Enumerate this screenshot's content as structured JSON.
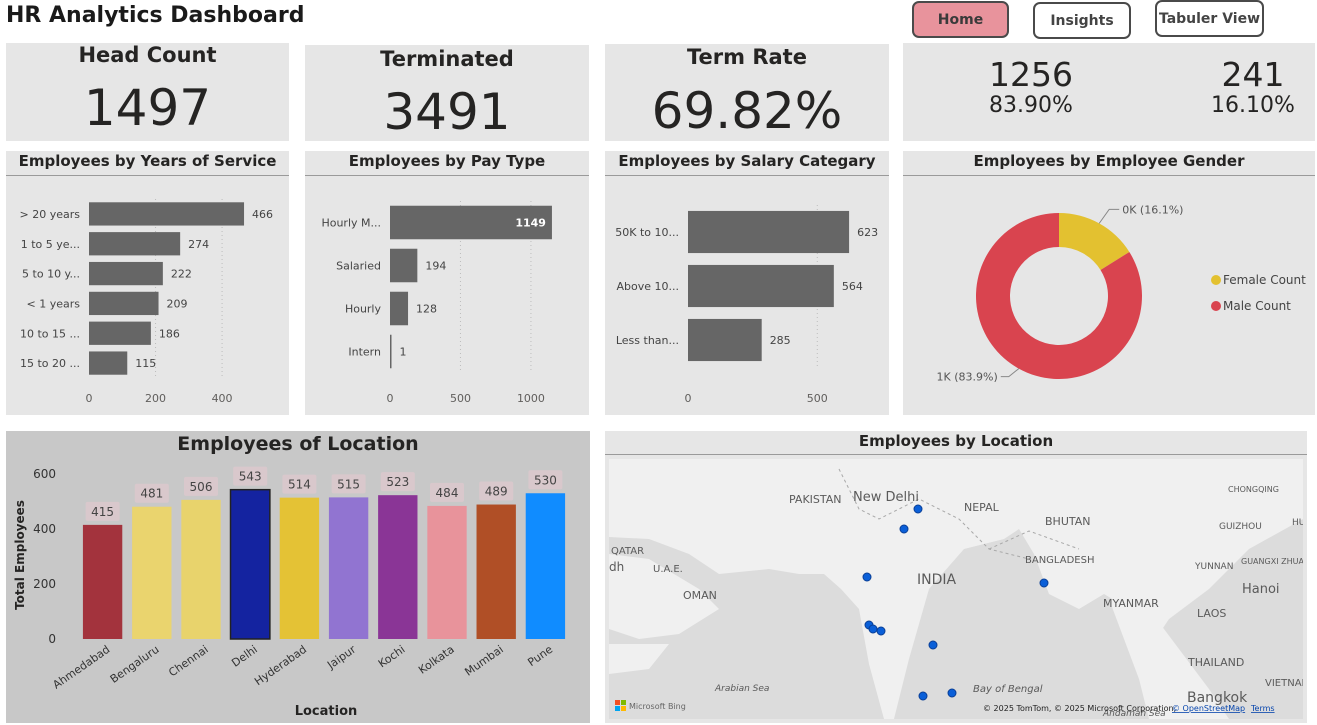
{
  "header": {
    "title": "HR Analytics Dashboard",
    "nav": [
      "Home",
      "Insights",
      "Tabuler View"
    ]
  },
  "kpis": [
    {
      "label": "Head Count",
      "value": "1497"
    },
    {
      "label": "Terminated",
      "value": "3491"
    },
    {
      "label": "Term Rate",
      "value": "69.82%"
    }
  ],
  "split": {
    "left_count": "1256",
    "left_pct": "83.90%",
    "right_count": "241",
    "right_pct": "16.10%"
  },
  "panels": {
    "service_title": "Employees by Years of Service",
    "paytype_title": "Employees by Pay Type",
    "salary_title": "Employees by Salary Categary",
    "gender_title": "Employees by Employee Gender",
    "location_title": "Employees of Location",
    "map_title": "Employees by Location"
  },
  "map": {
    "labels": [
      "PAKISTAN",
      "New Delhi",
      "NEPAL",
      "BHUTAN",
      "BANGLADESH",
      "INDIA",
      "OMAN",
      "QATAR",
      "U.A.E.",
      "dh",
      "MYANMAR",
      "LAOS",
      "Hanoi",
      "YUNNAN",
      "GUIZHOU",
      "GUANGXI ZHUANG",
      "CHONGQING",
      "HU",
      "VIETNAM",
      "THAILAND",
      "Bangkok",
      "Arabian Sea",
      "Bay of Bengal",
      "Andaman Sea"
    ],
    "attribution": "© 2025 TomTom, © 2025 Microsoft Corporation,",
    "osm_link": "© OpenStreetMap",
    "terms_link": "Terms",
    "bing_label": "Microsoft Bing"
  },
  "colors": {
    "bar_gray": "#666666",
    "female": "#e3c130",
    "male": "#d9444f",
    "home_active": "#e8939c",
    "map_dot": "#0a5fd8"
  },
  "chart_data": [
    {
      "id": "service",
      "type": "bar",
      "orientation": "horizontal",
      "title": "Employees by Years of Service",
      "categories": [
        "> 20 years",
        "1 to 5 ye...",
        "5 to 10 y...",
        "< 1 years",
        "10 to 15 ...",
        "15 to 20 ..."
      ],
      "values": [
        466,
        274,
        222,
        209,
        186,
        115
      ],
      "xlim": [
        0,
        520
      ],
      "ticks": [
        0,
        200,
        400
      ]
    },
    {
      "id": "paytype",
      "type": "bar",
      "orientation": "horizontal",
      "title": "Employees by Pay Type",
      "categories": [
        "Hourly M...",
        "Salaried",
        "Hourly",
        "Intern"
      ],
      "values": [
        1149,
        194,
        128,
        1
      ],
      "xlim": [
        0,
        1270
      ],
      "ticks": [
        0,
        500,
        1000
      ]
    },
    {
      "id": "salary",
      "type": "bar",
      "orientation": "horizontal",
      "title": "Employees by Salary Categary",
      "categories": [
        "50K to 10...",
        "Above 10...",
        "Less than..."
      ],
      "values": [
        623,
        564,
        285
      ],
      "xlim": [
        0,
        700
      ],
      "ticks": [
        0,
        500
      ]
    },
    {
      "id": "gender",
      "type": "pie",
      "title": "Employees by Employee Gender",
      "legend": [
        "Female Count",
        "Male Count"
      ],
      "values": [
        241,
        1256
      ],
      "labels": [
        "0K (16.1%)",
        "1K (83.9%)"
      ],
      "legend_position": "right"
    },
    {
      "id": "location",
      "type": "bar",
      "orientation": "vertical",
      "title": "Employees of Location",
      "xlabel": "Location",
      "ylabel": "Total Employees",
      "categories": [
        "Ahmedabad",
        "Bengaluru",
        "Chennai",
        "Delhi",
        "Hyderabad",
        "Jaipur",
        "Kochi",
        "Kolkata",
        "Mumbai",
        "Pune"
      ],
      "values": [
        415,
        481,
        506,
        543,
        514,
        515,
        523,
        484,
        489,
        530
      ],
      "colors": [
        "#a3333d",
        "#ead46e",
        "#e8d36c",
        "#1423a0",
        "#e4c235",
        "#9174d1",
        "#8a3596",
        "#e8939b",
        "#b04f26",
        "#108cff"
      ],
      "ylim": [
        0,
        600
      ],
      "ticks": [
        0,
        200,
        400,
        600
      ]
    }
  ]
}
